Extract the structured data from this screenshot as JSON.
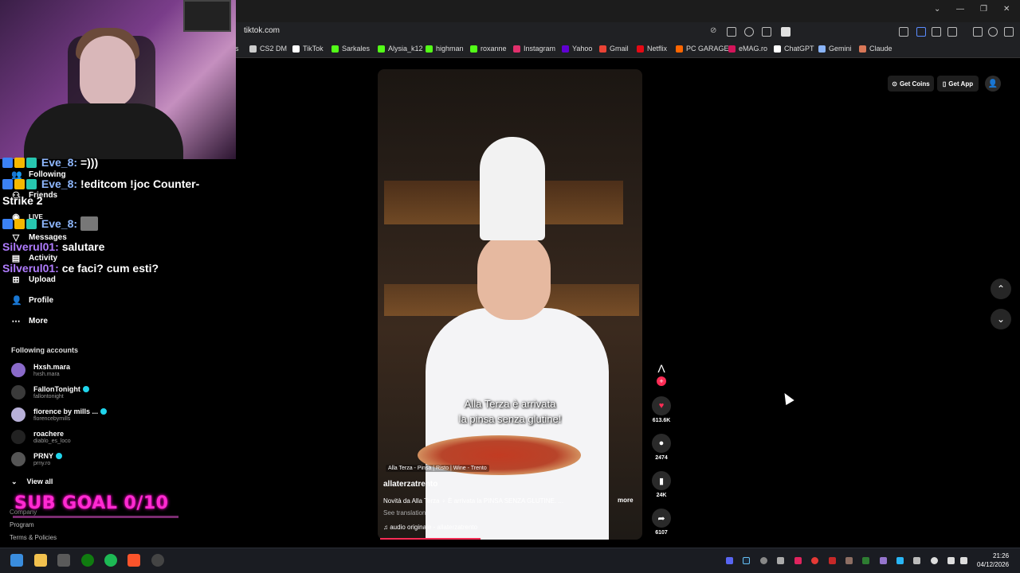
{
  "browser": {
    "url": "tiktok.com",
    "bookmarks": [
      {
        "label": "rs",
        "color": "#888888"
      },
      {
        "label": "CS2 DM",
        "color": "#cccccc"
      },
      {
        "label": "TikTok",
        "color": "#ffffff"
      },
      {
        "label": "Sarkales",
        "color": "#53fc18"
      },
      {
        "label": "Alysia_k12",
        "color": "#53fc18"
      },
      {
        "label": "highman",
        "color": "#53fc18"
      },
      {
        "label": "roxanne",
        "color": "#53fc18"
      },
      {
        "label": "Instagram",
        "color": "#e1306c"
      },
      {
        "label": "Yahoo",
        "color": "#6001d2"
      },
      {
        "label": "Gmail",
        "color": "#ea4335"
      },
      {
        "label": "Netflix",
        "color": "#e50914"
      },
      {
        "label": "PC GARAGE",
        "color": "#ff6600"
      },
      {
        "label": "eMAG.ro",
        "color": "#d4145a"
      },
      {
        "label": "ChatGPT",
        "color": "#ffffff"
      },
      {
        "label": "Gemini",
        "color": "#8ab4f8"
      },
      {
        "label": "Claude",
        "color": "#d97757"
      }
    ]
  },
  "sidebar": {
    "nav": [
      {
        "label": "Following",
        "icon": "following-icon"
      },
      {
        "label": "Friends",
        "icon": "friends-icon"
      },
      {
        "label": "LIVE",
        "icon": "live-icon"
      },
      {
        "label": "Messages",
        "icon": "messages-icon"
      },
      {
        "label": "Activity",
        "icon": "activity-icon"
      },
      {
        "label": "Upload",
        "icon": "upload-icon"
      },
      {
        "label": "Profile",
        "icon": "profile-icon"
      },
      {
        "label": "More",
        "icon": "more-icon"
      }
    ],
    "following_title": "Following accounts",
    "accounts": [
      {
        "name": "Hxsh.mara",
        "handle": "hxsh.mara",
        "verified": false,
        "color": "#8a6ac9"
      },
      {
        "name": "FallonTonight",
        "handle": "fallontonight",
        "verified": true,
        "color": "#3a3a3a"
      },
      {
        "name": "florence by mills ...",
        "handle": "florencebymills",
        "verified": true,
        "color": "#b8b0d8"
      },
      {
        "name": "roachere",
        "handle": "diablo_es_loco",
        "verified": false,
        "color": "#222222"
      },
      {
        "name": "PRNY",
        "handle": "prny.ro",
        "verified": true,
        "color": "#555555"
      }
    ],
    "view_all": "View all",
    "footer": [
      "Company",
      "Program",
      "Terms & Policies"
    ]
  },
  "chat": [
    {
      "user": "Eve_8:",
      "message": "=)))",
      "type": "eve"
    },
    {
      "user": "Eve_8:",
      "message": "!editcom !joc Counter-",
      "type": "eve"
    },
    {
      "continuation": "Strike 2"
    },
    {
      "user": "Eve_8:",
      "message": "",
      "type": "eve"
    },
    {
      "user": "Silverul01:",
      "message": "salutare",
      "type": "sil"
    },
    {
      "user": "Silverul01:",
      "message": "ce faci? cum esti?",
      "type": "sil"
    }
  ],
  "overlay": {
    "sub_goal": "SUB GOAL 0/10"
  },
  "video": {
    "caption_line1": "Alla Terza è arrivata",
    "caption_line2": "la pinsa senza glutine!",
    "tag": "Alla Terza - Pinsa | Risto | Wine - Trento",
    "author": "allaterzatrento",
    "description": "Novità da Alla Terza ♀ È arrivata la PINSA SENZA GLUTINE. ...",
    "more": "more",
    "see_translation": "See translation",
    "audio": "audio originale - allaterzatrento",
    "progress": 0.38
  },
  "actions": {
    "likes": "613.6K",
    "comments": "2474",
    "saves": "24K",
    "shares": "6107"
  },
  "header": {
    "get_coins": "Get Coins",
    "get_app": "Get App"
  },
  "taskbar": {
    "time": "21:26",
    "date": "04/12/2026"
  }
}
